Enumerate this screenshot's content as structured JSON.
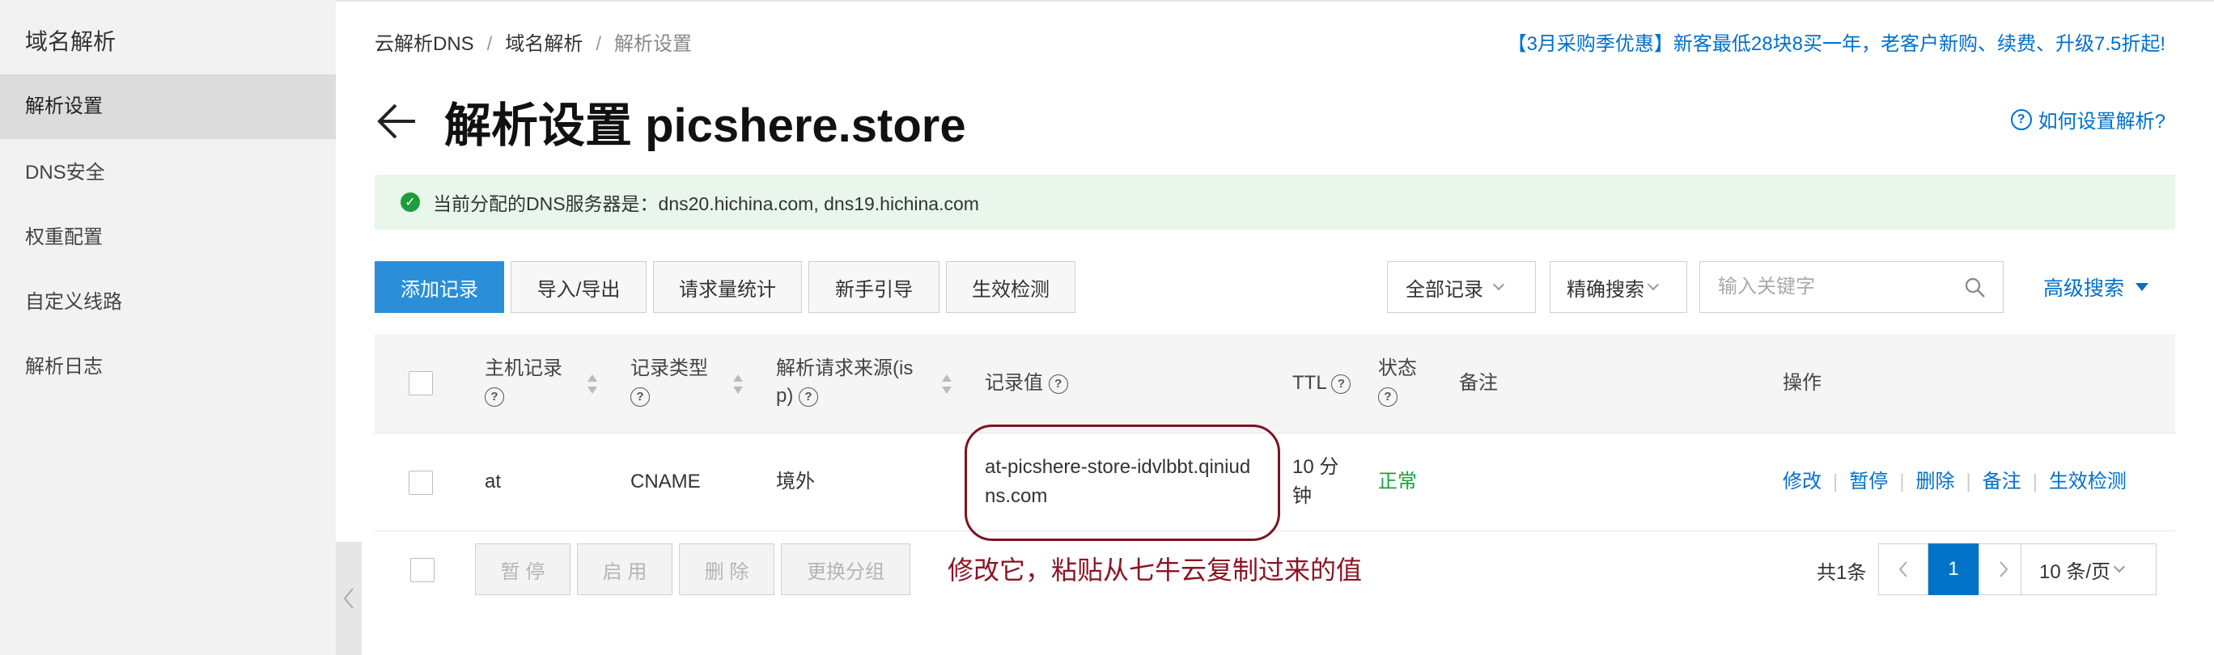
{
  "sidebar": {
    "title": "域名解析",
    "items": [
      {
        "label": "解析设置",
        "active": true
      },
      {
        "label": "DNS安全",
        "active": false
      },
      {
        "label": "权重配置",
        "active": false
      },
      {
        "label": "自定义线路",
        "active": false
      },
      {
        "label": "解析日志",
        "active": false
      }
    ]
  },
  "breadcrumb": [
    "云解析DNS",
    "域名解析",
    "解析设置"
  ],
  "promo_text": "【3月采购季优惠】新客最低28块8买一年，老客户新购、续费、升级7.5折起!",
  "page_title": "解析设置 picshere.store",
  "help_link": "如何设置解析?",
  "notice": {
    "text": "当前分配的DNS服务器是：dns20.hichina.com, dns19.hichina.com",
    "color": "#1f9d3c"
  },
  "toolbar": {
    "add_record": "添加记录",
    "import_export": "导入/导出",
    "request_stats": "请求量统计",
    "beginner_guide": "新手引导",
    "effect_check": "生效检测",
    "filter_all": "全部记录",
    "exact_search": "精确搜索",
    "search_placeholder": "输入关键字",
    "advanced_search": "高级搜索"
  },
  "table": {
    "headers": {
      "host": "主机记录",
      "type": "记录类型",
      "source_line1": "解析请求来源(is",
      "source_line2": "p)",
      "value": "记录值",
      "ttl": "TTL",
      "status": "状态",
      "note": "备注",
      "actions": "操作"
    },
    "rows": [
      {
        "host": "at",
        "type": "CNAME",
        "source": "境外",
        "value_line1": "at-picshere-store-idvlbbt.qiniud",
        "value_line2": "ns.com",
        "ttl_line1": "10 分",
        "ttl_line2": "钟",
        "status": "正常",
        "note": "",
        "actions": [
          "修改",
          "暂停",
          "删除",
          "备注",
          "生效检测"
        ]
      }
    ]
  },
  "bulk_actions": [
    "暂 停",
    "启 用",
    "删 除",
    "更换分组"
  ],
  "annotation": "修改它，粘贴从七牛云复制过来的值",
  "pagination": {
    "total": "共1条",
    "current_page": "1",
    "page_size": "10 条/页"
  },
  "colors": {
    "primary": "#2a8fd8",
    "link": "#0070cc",
    "annotation": "#8a1424",
    "success": "#1f9d3c"
  }
}
